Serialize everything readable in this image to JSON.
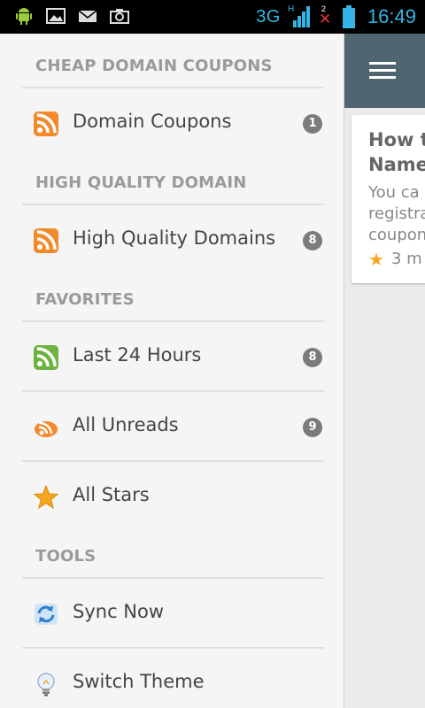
{
  "status_bar": {
    "network": "3G",
    "network_sub": "H",
    "sim_slot": "2",
    "time": "16:49",
    "accent_color": "#33b5e5"
  },
  "drawer": {
    "sections": [
      {
        "header": "CHEAP DOMAIN COUPONS",
        "items": [
          {
            "label": "Domain Coupons",
            "badge": "1",
            "icon": "rss-feed-icon"
          }
        ]
      },
      {
        "header": "HIGH QUALITY DOMAIN",
        "items": [
          {
            "label": "High Quality Domains",
            "badge": "8",
            "icon": "rss-feed-icon"
          }
        ]
      },
      {
        "header": "FAVORITES",
        "items": [
          {
            "label": "Last 24 Hours",
            "badge": "8",
            "icon": "rss-green-icon"
          },
          {
            "label": "All Unreads",
            "badge": "9",
            "icon": "unread-feed-icon"
          },
          {
            "label": "All Stars",
            "badge": "",
            "icon": "star-icon"
          }
        ]
      },
      {
        "header": "TOOLS",
        "items": [
          {
            "label": "Sync Now",
            "badge": "",
            "icon": "sync-icon"
          },
          {
            "label": "Switch Theme",
            "badge": "",
            "icon": "lightbulb-icon"
          }
        ]
      }
    ]
  },
  "main": {
    "appbar_color": "#4f6570",
    "card": {
      "title": "How t\nName",
      "snippet": "You ca\nregistra\ncoupon",
      "meta": "3 m"
    }
  }
}
